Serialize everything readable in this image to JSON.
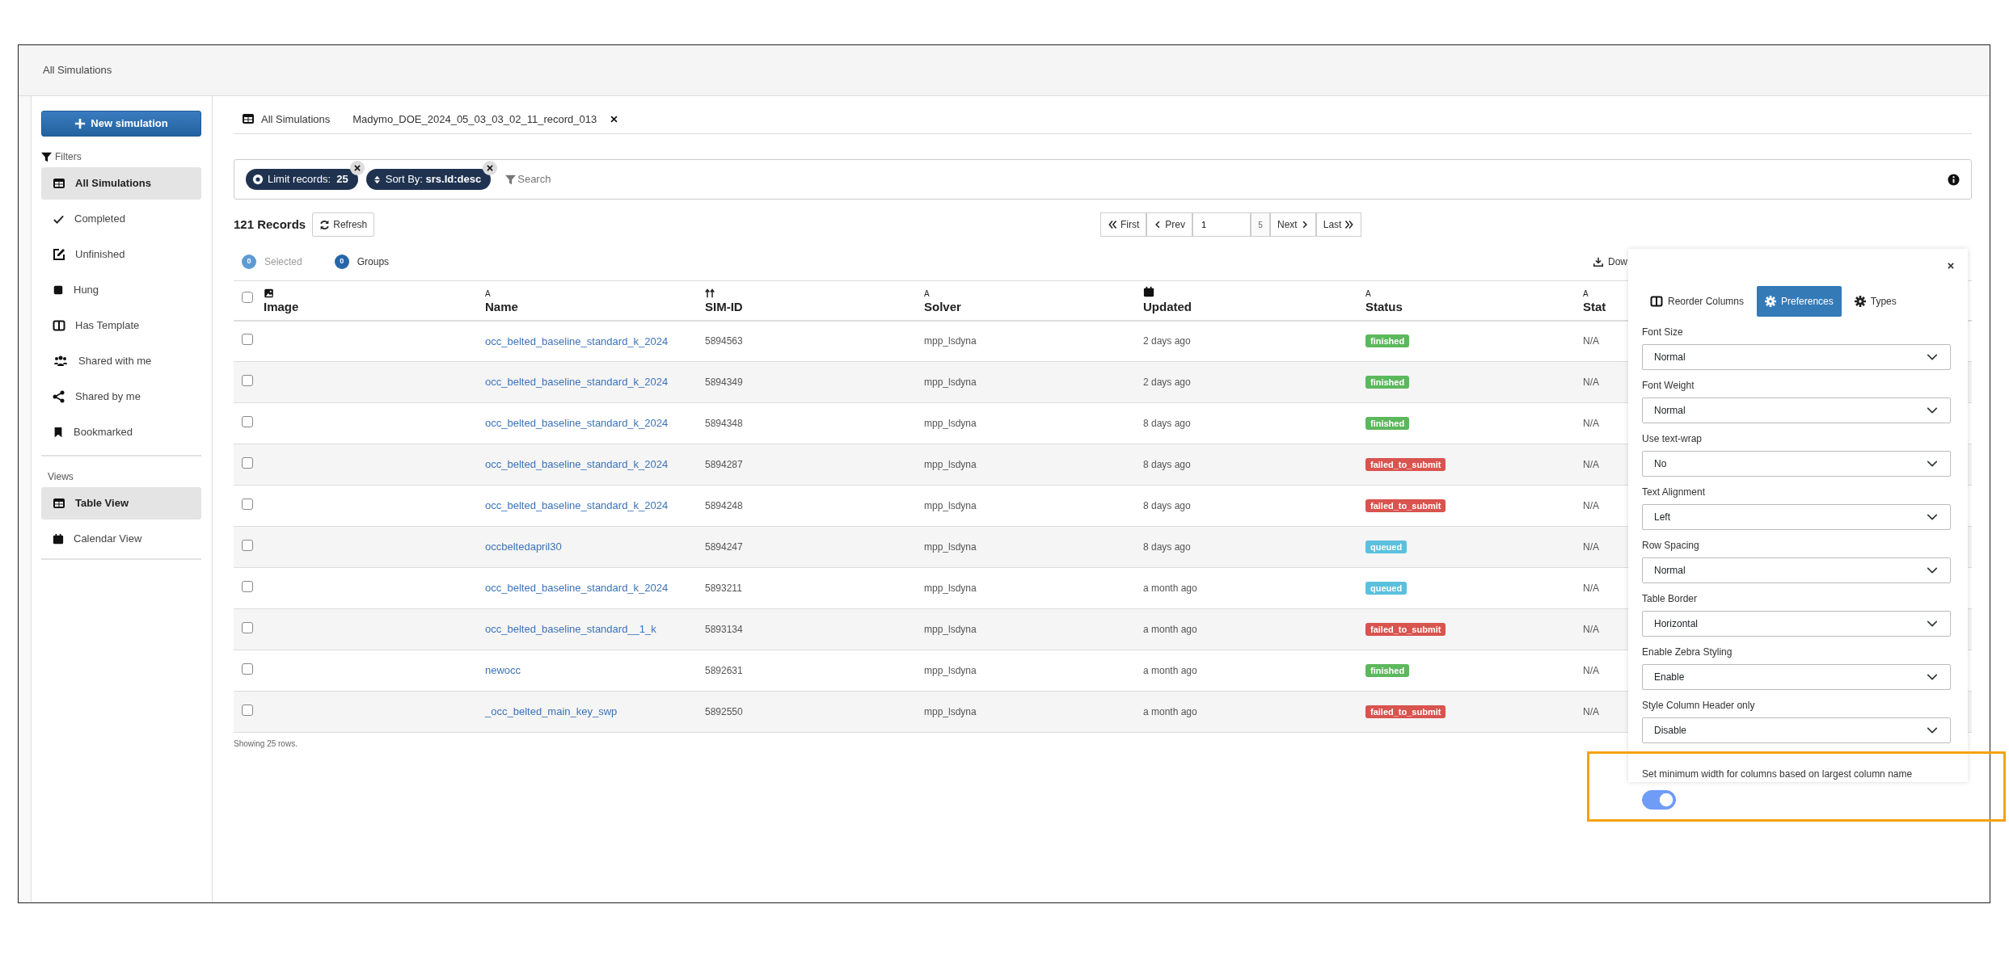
{
  "header": {
    "title": "All Simulations"
  },
  "sidebar": {
    "new_button": "New simulation",
    "filters_label": "Filters",
    "filters": [
      {
        "label": "All Simulations",
        "selected": true
      },
      {
        "label": "Completed",
        "selected": false
      },
      {
        "label": "Unfinished",
        "selected": false
      },
      {
        "label": "Hung",
        "selected": false
      },
      {
        "label": "Has Template",
        "selected": false
      },
      {
        "label": "Shared with me",
        "selected": false
      },
      {
        "label": "Shared by me",
        "selected": false
      },
      {
        "label": "Bookmarked",
        "selected": false
      }
    ],
    "views_label": "Views",
    "views": [
      {
        "label": "Table View",
        "selected": true
      },
      {
        "label": "Calendar View",
        "selected": false
      }
    ]
  },
  "tabs": [
    {
      "label": "All Simulations",
      "closable": false
    },
    {
      "label": "Madymo_DOE_2024_05_03_03_02_11_record_013",
      "closable": true
    }
  ],
  "filter_bar": {
    "chips": [
      {
        "text": "Limit records:  **25**"
      },
      {
        "text": "Sort By: **srs.Id:desc**"
      }
    ],
    "search": {
      "placeholder": "Search"
    }
  },
  "records": {
    "count": "121 Records",
    "refresh": "Refresh"
  },
  "pagination": {
    "first": "First",
    "prev": "Prev",
    "page": "1",
    "total": "5",
    "next": "Next",
    "last": "Last"
  },
  "counters": [
    {
      "count": "0",
      "label": "Selected",
      "disabled": true
    },
    {
      "count": "0",
      "label": "Groups",
      "disabled": false
    }
  ],
  "download": "Dow",
  "table": {
    "all_selected": false,
    "columns": [
      {
        "kind": "image",
        "label": "Image"
      },
      {
        "kind": "text",
        "glyph": "A",
        "label": "Name"
      },
      {
        "kind": "number",
        "label": "SIM-ID"
      },
      {
        "kind": "text",
        "glyph": "A",
        "label": "Solver"
      },
      {
        "kind": "date",
        "label": "Updated"
      },
      {
        "kind": "text",
        "glyph": "A",
        "label": "Status"
      },
      {
        "kind": "text",
        "glyph": "A",
        "label": "Stat"
      }
    ],
    "rows": [
      {
        "selected": false,
        "name": "occ_belted_baseline_standard_k_2024",
        "sim_id": "5894563",
        "solver": "mpp_lsdyna",
        "updated": "2 days ago",
        "status": {
          "text": "finished",
          "color": "#5cb85c"
        },
        "column_8": "N/A"
      },
      {
        "selected": false,
        "name": "occ_belted_baseline_standard_k_2024",
        "sim_id": "5894349",
        "solver": "mpp_lsdyna",
        "updated": "2 days ago",
        "status": {
          "text": "finished",
          "color": "#5cb85c"
        },
        "column_8": "N/A"
      },
      {
        "selected": false,
        "name": "occ_belted_baseline_standard_k_2024",
        "sim_id": "5894348",
        "solver": "mpp_lsdyna",
        "updated": "8 days ago",
        "status": {
          "text": "finished",
          "color": "#5cb85c"
        },
        "column_8": "N/A"
      },
      {
        "selected": false,
        "name": "occ_belted_baseline_standard_k_2024",
        "sim_id": "5894287",
        "solver": "mpp_lsdyna",
        "updated": "8 days ago",
        "status": {
          "text": "failed_to_submit",
          "color": "#d9534f"
        },
        "column_8": "N/A"
      },
      {
        "selected": false,
        "name": "occ_belted_baseline_standard_k_2024",
        "sim_id": "5894248",
        "solver": "mpp_lsdyna",
        "updated": "8 days ago",
        "status": {
          "text": "failed_to_submit",
          "color": "#d9534f"
        },
        "column_8": "N/A"
      },
      {
        "selected": false,
        "name": "occbeltedapril30",
        "sim_id": "5894247",
        "solver": "mpp_lsdyna",
        "updated": "8 days ago",
        "status": {
          "text": "queued",
          "color": "#5bc0de"
        },
        "column_8": "N/A"
      },
      {
        "selected": false,
        "name": "occ_belted_baseline_standard_k_2024",
        "sim_id": "5893211",
        "solver": "mpp_lsdyna",
        "updated": "a month ago",
        "status": {
          "text": "queued",
          "color": "#5bc0de"
        },
        "column_8": "N/A"
      },
      {
        "selected": false,
        "name": "occ_belted_baseline_standard__1_k",
        "sim_id": "5893134",
        "solver": "mpp_lsdyna",
        "updated": "a month ago",
        "status": {
          "text": "failed_to_submit",
          "color": "#d9534f"
        },
        "column_8": "N/A"
      },
      {
        "selected": false,
        "name": "newocc",
        "sim_id": "5892631",
        "solver": "mpp_lsdyna",
        "updated": "a month ago",
        "status": {
          "text": "finished",
          "color": "#5cb85c"
        },
        "column_8": "N/A"
      },
      {
        "selected": false,
        "name": "_occ_belted_main_key_swp",
        "sim_id": "5892550",
        "solver": "mpp_lsdyna",
        "updated": "a month ago",
        "status": {
          "text": "failed_to_submit",
          "color": "#d9534f"
        },
        "column_8": "N/A"
      }
    ],
    "footer": "Showing 25 rows."
  },
  "preferences": {
    "tabs": [
      {
        "label": "Reorder Columns",
        "selected": false
      },
      {
        "label": "Preferences",
        "selected": true
      },
      {
        "label": "Types",
        "selected": false
      }
    ],
    "fields": [
      {
        "label": "Font Size",
        "value": "Normal"
      },
      {
        "label": "Font Weight",
        "value": "Normal"
      },
      {
        "label": "Use text-wrap",
        "value": "No"
      },
      {
        "label": "Text Alignment",
        "value": "Left"
      },
      {
        "label": "Row Spacing",
        "value": "Normal"
      },
      {
        "label": "Table Border",
        "value": "Horizontal"
      },
      {
        "label": "Enable Zebra Styling",
        "value": "Enable"
      },
      {
        "label": "Style Column Header only",
        "value": "Disable"
      }
    ],
    "min_width": {
      "label": "Set minimum width for columns based on largest column name",
      "on": true,
      "highlighted": true
    }
  }
}
